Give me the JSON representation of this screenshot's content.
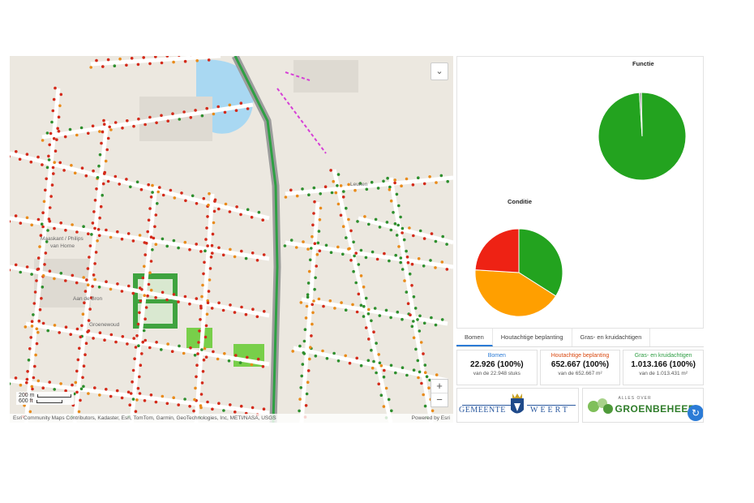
{
  "map": {
    "toggle_icon": "chevron-down-icon",
    "labels": {
      "leuken": "Leuken",
      "maaskant": "Maaskant / Philips",
      "van_horne": "van Horne",
      "aan_de_bron": "Aan de Bron",
      "groenewoud": "Groenewoud"
    },
    "scalebar": {
      "top_label": "200 m",
      "bottom_label": "600 ft"
    },
    "zoom": {
      "in_label": "+",
      "out_label": "−"
    },
    "attribution": "Esri Community Maps Contributors, Kadaster, Esri, TomTom, Garmin, GeoTechnologies, Inc, METI/NASA, USGS",
    "powered_by": "Powered by Esri"
  },
  "charts": {
    "functie_title": "Functie",
    "conditie_title": "Conditie"
  },
  "chart_data": [
    {
      "type": "pie",
      "title": "Functie",
      "slices": [
        {
          "value": 99.3,
          "color": "#23a31f"
        },
        {
          "value": 0.7,
          "color": "#8a8a8a"
        }
      ]
    },
    {
      "type": "pie",
      "title": "Conditie",
      "slices": [
        {
          "value": 34,
          "color": "#23a31f"
        },
        {
          "value": 42,
          "color": "#ff9f00"
        },
        {
          "value": 24,
          "color": "#ee2214"
        }
      ]
    }
  ],
  "tabs": [
    "Bomen",
    "Houtachtige beplanting",
    "Gras- en kruidachtigen"
  ],
  "cards": [
    {
      "title": "Bomen",
      "value": "22.926 (100%)",
      "sub": "van de 22.948 stuks",
      "color": "#2b7bd6"
    },
    {
      "title": "Houtachtige beplanting",
      "value": "652.667 (100%)",
      "sub": "van de 652.667 m²",
      "color": "#d9480f"
    },
    {
      "title": "Gras- en kruidachtigen",
      "value": "1.013.166 (100%)",
      "sub": "van de 1.013.431 m²",
      "color": "#2f9e44"
    }
  ],
  "logos": {
    "weert_left": "GEMEENTE",
    "weert_right": "WEERT",
    "groen_small": "ALLES OVER",
    "groen_big": "GROENBEHEER"
  },
  "colors": {
    "green": "#23a31f",
    "orange": "#ff9f00",
    "red": "#ee2214",
    "water": "#a9d8f2"
  }
}
